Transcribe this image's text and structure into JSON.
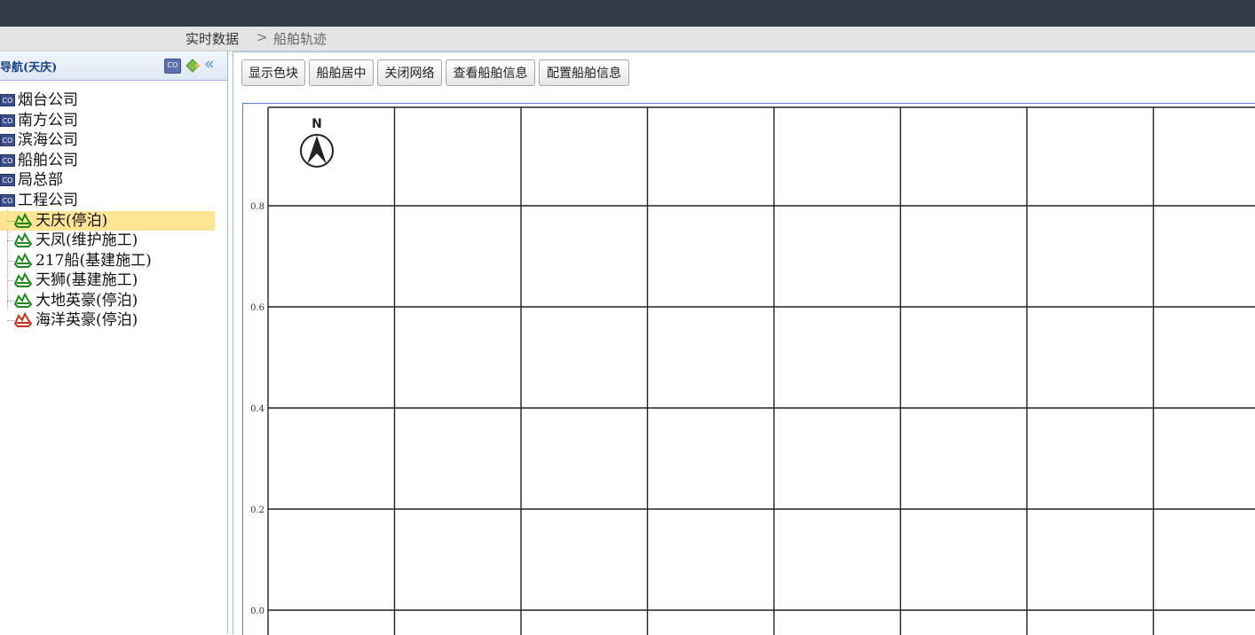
{
  "breadcrumb": {
    "parent": "实时数据",
    "separator": ">",
    "current": "船舶轨迹"
  },
  "sidebar": {
    "title": "导航(天庆)",
    "header_icons": [
      "co-icon",
      "diamond-arrow-icon",
      "double-chevron-left-icon"
    ],
    "companies": [
      {
        "label": "烟台公司"
      },
      {
        "label": "南方公司"
      },
      {
        "label": "滨海公司"
      },
      {
        "label": "船舶公司"
      },
      {
        "label": "局总部"
      },
      {
        "label": "工程公司"
      }
    ],
    "co_icon_text": "CO",
    "ships": [
      {
        "label": "天庆(停泊)",
        "selected": true,
        "color": "#1a8a1a"
      },
      {
        "label": "天凤(维护施工)",
        "selected": false,
        "color": "#1a8a1a"
      },
      {
        "label": "217船(基建施工)",
        "selected": false,
        "color": "#1a8a1a"
      },
      {
        "label": "天狮(基建施工)",
        "selected": false,
        "color": "#1a8a1a"
      },
      {
        "label": "大地英豪(停泊)",
        "selected": false,
        "color": "#1a8a1a"
      },
      {
        "label": "海洋英豪(停泊)",
        "selected": false,
        "color": "#d0301a"
      }
    ]
  },
  "toolbar": {
    "show_color_blocks": "显示色块",
    "center_ship": "船舶居中",
    "close_grid": "关闭网络",
    "view_ship_info": "查看船舶信息",
    "config_ship_info": "配置船舶信息"
  },
  "map": {
    "north_label": "N",
    "y_ticks": [
      "0.8",
      "0.6",
      "0.4",
      "0.2",
      "0.0"
    ]
  },
  "colors": {
    "topbar": "#323a47",
    "selected": "#fde594",
    "accent": "#15428b"
  }
}
